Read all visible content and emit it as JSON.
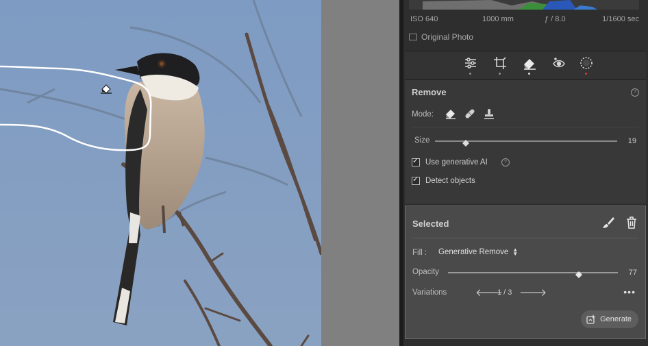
{
  "histogram": {
    "iso": "ISO 640",
    "focal": "1000 mm",
    "aperture": "ƒ / 8.0",
    "shutter": "1/1600 sec",
    "original_photo_label": "Original Photo"
  },
  "toolbar": {
    "tools": [
      "edit-sliders-icon",
      "crop-icon",
      "eraser-icon",
      "red-eye-icon",
      "masking-icon"
    ]
  },
  "remove": {
    "title": "Remove",
    "mode_label": "Mode:",
    "size_label": "Size",
    "size_value": "19",
    "size_level": 0.17,
    "use_generative_ai": "Use generative AI",
    "detect_objects": "Detect objects"
  },
  "selected": {
    "title": "Selected",
    "fill_label": "Fill :",
    "fill_value": "Generative Remove",
    "opacity_label": "Opacity",
    "opacity_value": "77",
    "opacity_level": 0.77,
    "variations_label": "Variations",
    "variations_value": "1 / 3",
    "generate_label": "Generate"
  },
  "colors": {
    "sky": "#7f9bc0",
    "panel": "#383838",
    "selected_bg": "#4a4a4a",
    "accent_dot": "#e0392b"
  }
}
